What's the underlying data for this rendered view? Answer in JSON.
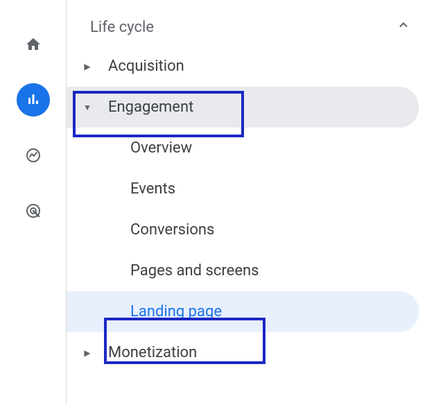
{
  "section": {
    "title": "Life cycle"
  },
  "nav": {
    "items": [
      {
        "label": "Acquisition",
        "expanded": false
      },
      {
        "label": "Engagement",
        "expanded": true,
        "children": [
          {
            "label": "Overview"
          },
          {
            "label": "Events"
          },
          {
            "label": "Conversions"
          },
          {
            "label": "Pages and screens"
          },
          {
            "label": "Landing page",
            "selected": true
          }
        ]
      },
      {
        "label": "Monetization",
        "expanded": false
      }
    ]
  },
  "colors": {
    "accent": "#1a73e8",
    "highlight_border": "#1b29c2"
  }
}
